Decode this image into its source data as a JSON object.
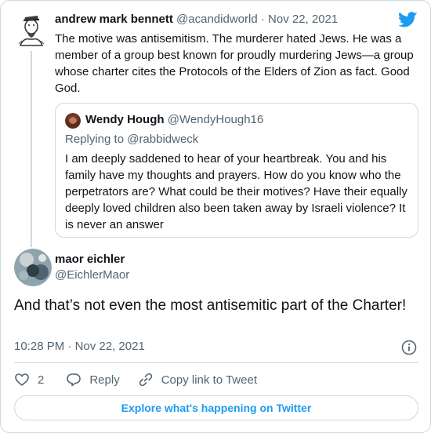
{
  "parent_tweet": {
    "name": "andrew mark bennett",
    "handle": "@acandidworld",
    "separator": "·",
    "date": "Nov 22, 2021",
    "text": "The motive was antisemitism. The murderer hated Jews. He was a member of a group best known for proudly murdering Jews—a group whose charter cites the Protocols of the Elders of Zion as fact. Good God."
  },
  "quoted_tweet": {
    "name": "Wendy Hough",
    "handle": "@WendyHough16",
    "replying_to": "Replying to @rabbidweck",
    "text": "I am deeply saddened to hear of your heartbreak. You and his family have my thoughts and prayers. How do you know who the perpetrators are? What could be their motives? Have their equally deeply loved children also been taken away by Israeli violence? It is never an answer"
  },
  "main_tweet": {
    "name": "maor eichler",
    "handle": "@EichlerMaor",
    "text": "And that’s not even the most antisemitic part of the Charter!",
    "time": "10:28 PM",
    "separator": "·",
    "date": "Nov 22, 2021"
  },
  "actions": {
    "like_count": "2",
    "reply_label": "Reply",
    "copy_link_label": "Copy link to Tweet"
  },
  "explore_label": "Explore what's happening on Twitter",
  "colors": {
    "accent": "#1d9bf0",
    "text": "#0f1419",
    "muted": "#536471",
    "border": "#cfd9de"
  },
  "icons": {
    "logo": "twitter-bird-icon",
    "info": "info-icon",
    "like": "heart-icon",
    "reply": "speech-bubble-icon",
    "copy_link": "link-icon"
  }
}
